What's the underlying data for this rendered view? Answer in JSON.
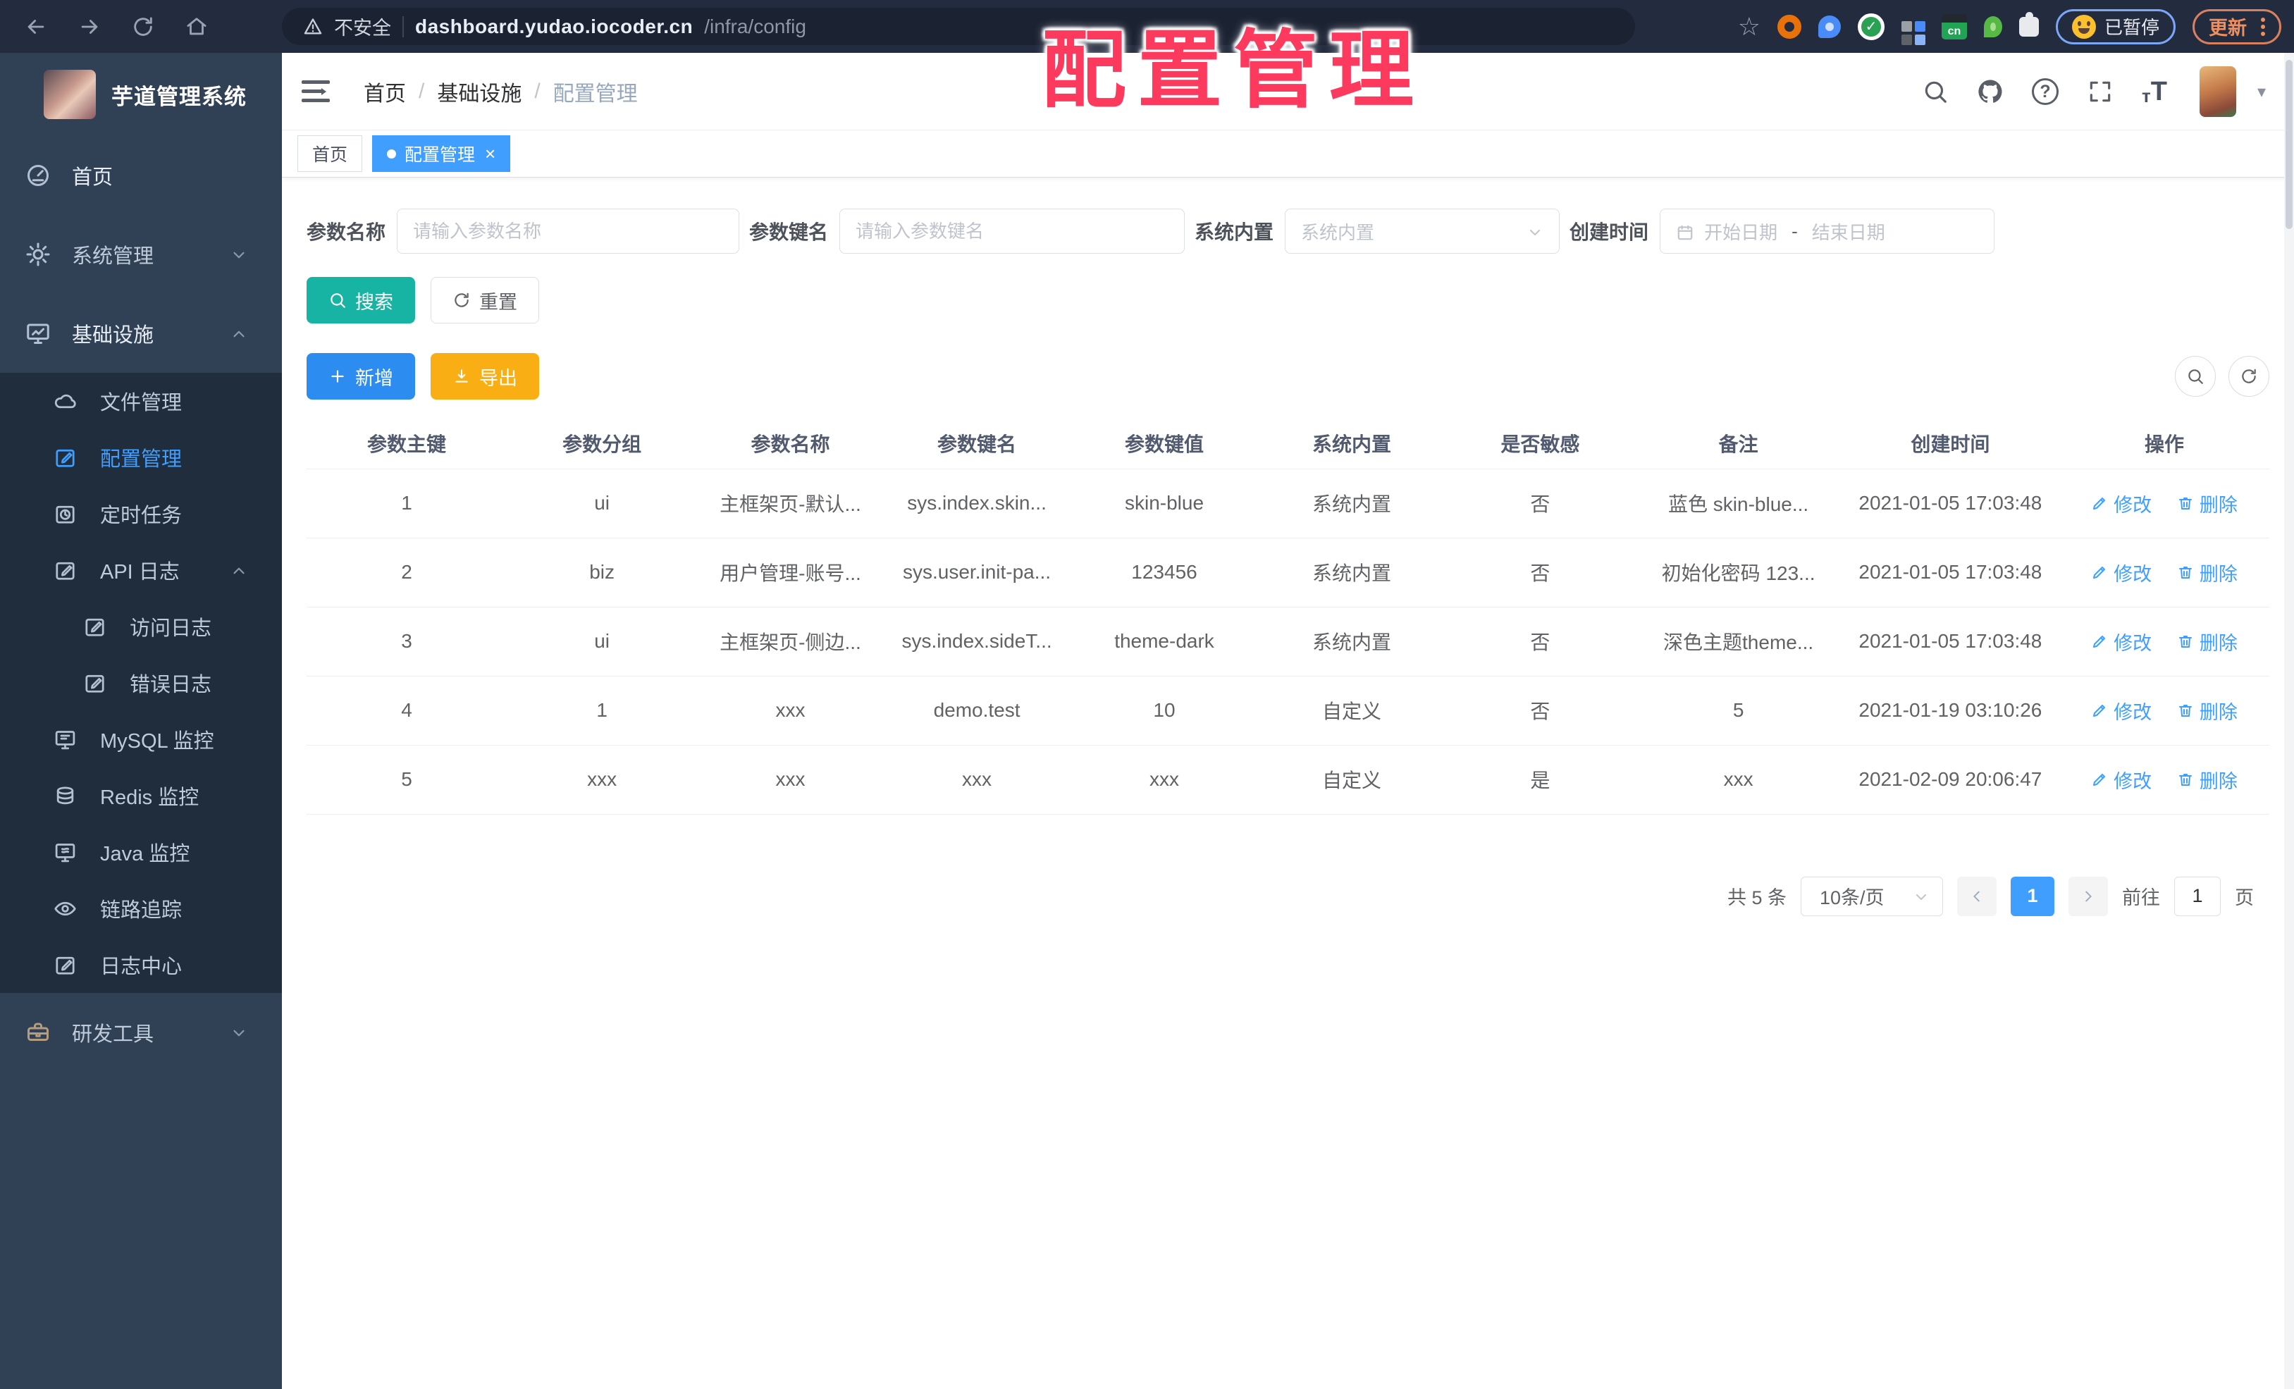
{
  "browser": {
    "security_label": "不安全",
    "url_host": "dashboard.yudao.iocoder.cn",
    "url_path": "/infra/config",
    "cn_badge": "cn",
    "paused_label": "已暂停",
    "update_label": "更新"
  },
  "overlay_title": "配置管理",
  "sidebar": {
    "app_title": "芋道管理系统",
    "items": [
      {
        "label": "首页"
      },
      {
        "label": "系统管理"
      },
      {
        "label": "基础设施"
      },
      {
        "label": "文件管理"
      },
      {
        "label": "配置管理"
      },
      {
        "label": "定时任务"
      },
      {
        "label": "API 日志"
      },
      {
        "label": "访问日志"
      },
      {
        "label": "错误日志"
      },
      {
        "label": "MySQL 监控"
      },
      {
        "label": "Redis 监控"
      },
      {
        "label": "Java 监控"
      },
      {
        "label": "链路追踪"
      },
      {
        "label": "日志中心"
      },
      {
        "label": "研发工具"
      }
    ]
  },
  "breadcrumb": {
    "items": [
      "首页",
      "基础设施",
      "配置管理"
    ]
  },
  "tags": [
    {
      "label": "首页"
    },
    {
      "label": "配置管理"
    }
  ],
  "filters": {
    "name_label": "参数名称",
    "name_placeholder": "请输入参数名称",
    "key_label": "参数键名",
    "key_placeholder": "请输入参数键名",
    "type_label": "系统内置",
    "type_placeholder": "系统内置",
    "date_label": "创建时间",
    "date_start_placeholder": "开始日期",
    "date_separator": "-",
    "date_end_placeholder": "结束日期"
  },
  "buttons": {
    "search": "搜索",
    "reset": "重置",
    "add": "新增",
    "export": "导出"
  },
  "table": {
    "headers": [
      "参数主键",
      "参数分组",
      "参数名称",
      "参数键名",
      "参数键值",
      "系统内置",
      "是否敏感",
      "备注",
      "创建时间",
      "操作"
    ],
    "edit_label": "修改",
    "delete_label": "删除",
    "rows": [
      [
        "1",
        "ui",
        "主框架页-默认...",
        "sys.index.skin...",
        "skin-blue",
        "系统内置",
        "否",
        "蓝色 skin-blue...",
        "2021-01-05 17:03:48"
      ],
      [
        "2",
        "biz",
        "用户管理-账号...",
        "sys.user.init-pa...",
        "123456",
        "系统内置",
        "否",
        "初始化密码 123...",
        "2021-01-05 17:03:48"
      ],
      [
        "3",
        "ui",
        "主框架页-侧边...",
        "sys.index.sideT...",
        "theme-dark",
        "系统内置",
        "否",
        "深色主题theme...",
        "2021-01-05 17:03:48"
      ],
      [
        "4",
        "1",
        "xxx",
        "demo.test",
        "10",
        "自定义",
        "否",
        "5",
        "2021-01-19 03:10:26"
      ],
      [
        "5",
        "xxx",
        "xxx",
        "xxx",
        "xxx",
        "自定义",
        "是",
        "xxx",
        "2021-02-09 20:06:47"
      ]
    ]
  },
  "pagination": {
    "total": "共 5 条",
    "page_size": "10条/页",
    "current_page": "1",
    "goto_label": "前往",
    "goto_value": "1",
    "page_unit": "页"
  },
  "colors": {
    "accent_blue": "#409eff",
    "add_blue": "#2d8cf0",
    "search_teal": "#17b3a3",
    "export_yellow": "#f9ae13",
    "overlay_pink": "#fb3a5e",
    "sidebar_bg": "#304156",
    "submenu_bg": "#1f2d3d",
    "chrome_bg": "#232b3e"
  }
}
